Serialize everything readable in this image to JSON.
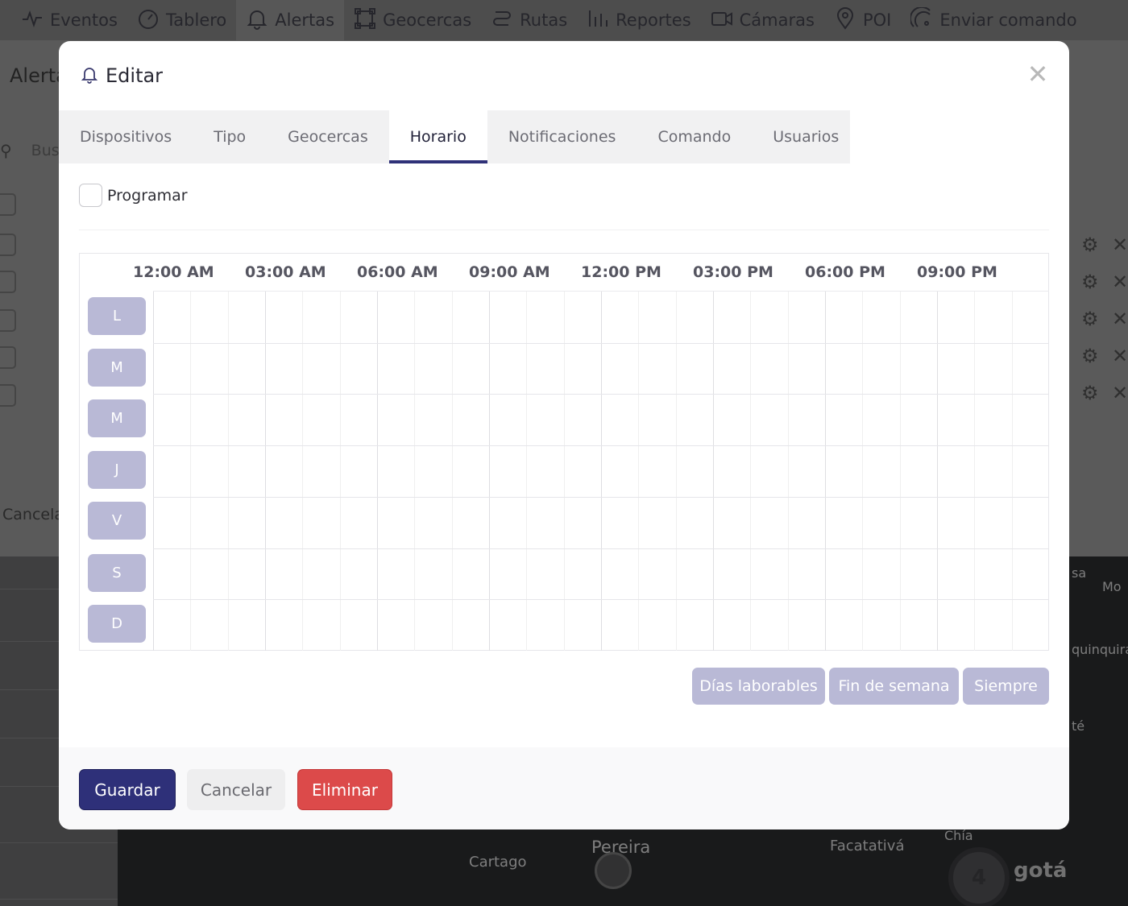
{
  "nav": {
    "items": [
      {
        "label": "Eventos",
        "icon": "activity-icon"
      },
      {
        "label": "Tablero",
        "icon": "gauge-icon"
      },
      {
        "label": "Alertas",
        "icon": "bell-icon"
      },
      {
        "label": "Geocercas",
        "icon": "geofence-icon"
      },
      {
        "label": "Rutas",
        "icon": "route-icon"
      },
      {
        "label": "Reportes",
        "icon": "bar-chart-icon"
      },
      {
        "label": "Cámaras",
        "icon": "camera-icon"
      },
      {
        "label": "POI",
        "icon": "map-pin-icon"
      },
      {
        "label": "Enviar comando",
        "icon": "satellite-icon"
      }
    ]
  },
  "background": {
    "title": "Alerta",
    "search_placeholder": "Bus",
    "cancel_label": "Cancela",
    "map_labels": [
      "Pereira",
      "Cartago",
      "Facatativá",
      "Chía",
      "gotá",
      "quinquira",
      "Mo",
      "sa",
      "té"
    ],
    "cluster_count": "4"
  },
  "modal": {
    "title": "Editar",
    "tabs": [
      {
        "label": "Dispositivos",
        "active": false
      },
      {
        "label": "Tipo",
        "active": false
      },
      {
        "label": "Geocercas",
        "active": false
      },
      {
        "label": "Horario",
        "active": true
      },
      {
        "label": "Notificaciones",
        "active": false
      },
      {
        "label": "Comando",
        "active": false
      },
      {
        "label": "Usuarios",
        "active": false
      }
    ],
    "program_label": "Programar",
    "program_checked": false,
    "hours": [
      "12:00 AM",
      "03:00 AM",
      "06:00 AM",
      "09:00 AM",
      "12:00 PM",
      "03:00 PM",
      "06:00 PM",
      "09:00 PM"
    ],
    "days": [
      "L",
      "M",
      "M",
      "J",
      "V",
      "S",
      "D"
    ],
    "presets": [
      "Días laborables",
      "Fin de semana",
      "Siempre"
    ],
    "footer": {
      "save_label": "Guardar",
      "cancel_label": "Cancelar",
      "delete_label": "Eliminar"
    },
    "colors": {
      "primary": "#2e3079",
      "danger": "#dc4a4a",
      "day_button": "#b9b9d6"
    }
  }
}
